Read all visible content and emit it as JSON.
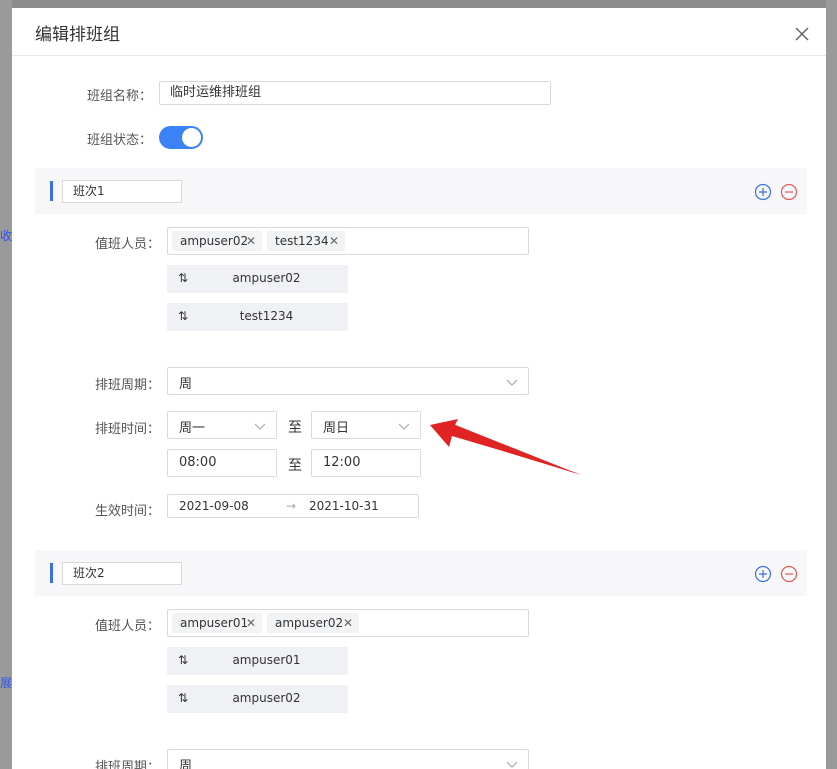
{
  "background": {
    "left_mark1": "收",
    "left_mark2": "展"
  },
  "modal": {
    "title": "编辑排班组"
  },
  "form": {
    "group_name_label": "班组名称：",
    "group_name_value": "临时运维排班组",
    "group_status_label": "班组状态："
  },
  "shifts": [
    {
      "name": "班次1",
      "staff_label": "值班人员：",
      "staff_tags": [
        "ampuser02",
        "test1234"
      ],
      "staff_order": [
        "ampuser02",
        "test1234"
      ],
      "period_label": "排班周期：",
      "period_value": "周",
      "time_label": "排班时间：",
      "day_from": "周一",
      "to_sep": "至",
      "day_to": "周日",
      "time_from": "08:00",
      "time_to": "12:00",
      "effective_label": "生效时间：",
      "date_from": "2021-09-08",
      "range_sep": "→",
      "date_to": "2021-10-31"
    },
    {
      "name": "班次2",
      "staff_label": "值班人员：",
      "staff_tags": [
        "ampuser01",
        "ampuser02"
      ],
      "staff_order": [
        "ampuser01",
        "ampuser02"
      ],
      "period_label": "排班周期：",
      "period_value": "周"
    }
  ],
  "colors": {
    "toggle_on": "#3b82f6",
    "accent": "#3b6fe0",
    "add_icon": "#3b6fe0",
    "remove_icon": "#e05a5a",
    "annotation_arrow": "#e02424"
  },
  "icons": {
    "close": "close-icon",
    "add": "plus-circle-icon",
    "remove": "minus-circle-icon",
    "sort": "sort-icon",
    "chevron": "chevron-down-icon"
  }
}
